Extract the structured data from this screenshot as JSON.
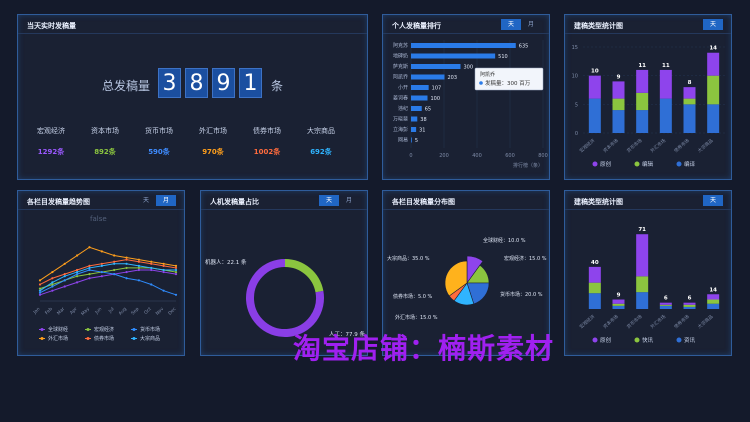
{
  "panels": {
    "realtime": {
      "title": "当天实时发稿量",
      "total_label": "总发稿量",
      "digits": [
        "3",
        "8",
        "9",
        "1"
      ],
      "unit": "条",
      "markets": [
        {
          "name": "宏观经济",
          "value": "1292条",
          "color": "#9b59ff"
        },
        {
          "name": "资本市场",
          "value": "892条",
          "color": "#8bc53f"
        },
        {
          "name": "货币市场",
          "value": "590条",
          "color": "#3f8cff"
        },
        {
          "name": "外汇市场",
          "value": "970条",
          "color": "#ff9f1c"
        },
        {
          "name": "债券市场",
          "value": "1002条",
          "color": "#ff6b3d"
        },
        {
          "name": "大宗商品",
          "value": "692条",
          "color": "#2fb4ff"
        }
      ]
    },
    "ranking": {
      "title": "个人发稿量排行",
      "toggle": [
        "天",
        "月"
      ],
      "axis_label": "排行榜（条）",
      "tooltip_name": "阿凯乔",
      "tooltip_text": "发稿量：300 百万"
    },
    "type_stats": {
      "title": "建稿类型统计图",
      "toggle": [
        "天"
      ],
      "legend": [
        "原创",
        "编辑",
        "编译"
      ]
    },
    "trend": {
      "title": "各栏目发稿量趋势图",
      "toggle": [
        "天",
        "月"
      ],
      "placeholder": "false",
      "legend": [
        "全球财经",
        "宏观经济",
        "货币市场",
        "外汇市场",
        "债券市场",
        "大宗商品"
      ]
    },
    "ratio": {
      "title": "人机发稿量占比",
      "toggle": [
        "天",
        "月"
      ],
      "label_robot": "机器人：22.1 条",
      "label_human": "人工：77.9 条"
    },
    "distribution": {
      "title": "各栏目发稿量分布图",
      "labels": [
        "全球财经：10.0 %",
        "宏观经济：15.0 %",
        "货币市场：20.0 %",
        "外汇市场：15.0 %",
        "债券市场：5.0 %",
        "大宗商品：35.0 %"
      ]
    },
    "type_stats2": {
      "title": "建稿类型统计图",
      "toggle": [
        "天"
      ],
      "legend": [
        "原创",
        "快讯",
        "资讯"
      ]
    }
  },
  "watermark": "淘宝店铺：楠斯素材",
  "colors": {
    "purple": "#8e44ec",
    "green": "#8bc53f",
    "blue": "#2f6fd6",
    "accent": "#2066c4"
  },
  "chart_data": [
    {
      "type": "bar",
      "orientation": "horizontal",
      "categories": [
        "阿克苏",
        "地碑奶",
        "萨克斯",
        "阿凯乔",
        "小开",
        "姜诃春",
        "违纪",
        "万晓斐",
        "立海彭",
        "网易"
      ],
      "values": [
        635,
        510,
        300,
        203,
        107,
        100,
        65,
        38,
        31,
        5
      ],
      "x_ticks": [
        "0",
        "200",
        "400",
        "600",
        "800"
      ],
      "xlim": [
        0,
        800
      ],
      "xlabel": "排行榜（条）"
    },
    {
      "type": "bar",
      "stacked": true,
      "categories": [
        "宏观经济",
        "资本市场",
        "货币市场",
        "外汇市场",
        "债券市场",
        "大宗商品"
      ],
      "series": [
        {
          "name": "原创",
          "values": [
            4,
            3,
            4,
            5,
            2,
            4
          ]
        },
        {
          "name": "编辑",
          "values": [
            0,
            2,
            3,
            0,
            1,
            5
          ]
        },
        {
          "name": "编译",
          "values": [
            6,
            4,
            4,
            6,
            5,
            5
          ]
        }
      ],
      "totals": [
        10,
        9,
        11,
        11,
        8,
        14
      ],
      "y_ticks": [
        "0",
        "5",
        "10",
        "15"
      ],
      "ylim": [
        0,
        15
      ]
    },
    {
      "type": "line",
      "categories": [
        "Jan",
        "Feb",
        "Mar",
        "Apr",
        "May",
        "Jun",
        "Jul",
        "Aug",
        "Sep",
        "Oct",
        "Nov",
        "Dec"
      ],
      "series": [
        {
          "name": "全球财经",
          "values": [
            3,
            5,
            7,
            9,
            11,
            12,
            13,
            14,
            15,
            15,
            14,
            13
          ]
        },
        {
          "name": "宏观经济",
          "values": [
            6,
            8,
            10,
            12,
            13,
            14,
            15,
            16,
            16,
            16,
            15,
            14
          ]
        },
        {
          "name": "货币市场",
          "values": [
            4,
            7,
            10,
            13,
            15,
            14,
            13,
            11,
            10,
            8,
            5,
            3
          ]
        },
        {
          "name": "外汇市场",
          "values": [
            10,
            14,
            18,
            22,
            26,
            24,
            22,
            21,
            20,
            19,
            18,
            17
          ]
        },
        {
          "name": "债券市场",
          "values": [
            8,
            11,
            13,
            15,
            17,
            18,
            19,
            20,
            19,
            18,
            17,
            16
          ]
        },
        {
          "name": "大宗商品",
          "values": [
            5,
            9,
            12,
            14,
            16,
            17,
            18,
            18,
            17,
            16,
            15,
            15
          ]
        }
      ],
      "ylim": [
        0,
        30
      ]
    },
    {
      "type": "pie",
      "donut": true,
      "categories": [
        "机器人",
        "人工"
      ],
      "values": [
        22.1,
        77.9
      ]
    },
    {
      "type": "pie",
      "categories": [
        "全球财经",
        "宏观经济",
        "货币市场",
        "外汇市场",
        "债券市场",
        "大宗商品"
      ],
      "values": [
        10,
        15,
        20,
        15,
        5,
        35
      ]
    },
    {
      "type": "bar",
      "stacked": true,
      "categories": [
        "宏观经济",
        "资本市场",
        "货币市场",
        "外汇市场",
        "债券市场",
        "大宗商品"
      ],
      "series": [
        {
          "name": "原创",
          "values": [
            15,
            4,
            40,
            2,
            2,
            5
          ]
        },
        {
          "name": "快讯",
          "values": [
            10,
            2,
            15,
            1,
            2,
            4
          ]
        },
        {
          "name": "资讯",
          "values": [
            15,
            3,
            16,
            3,
            2,
            5
          ]
        }
      ],
      "totals": [
        40,
        9,
        71,
        6,
        6,
        14
      ]
    }
  ]
}
